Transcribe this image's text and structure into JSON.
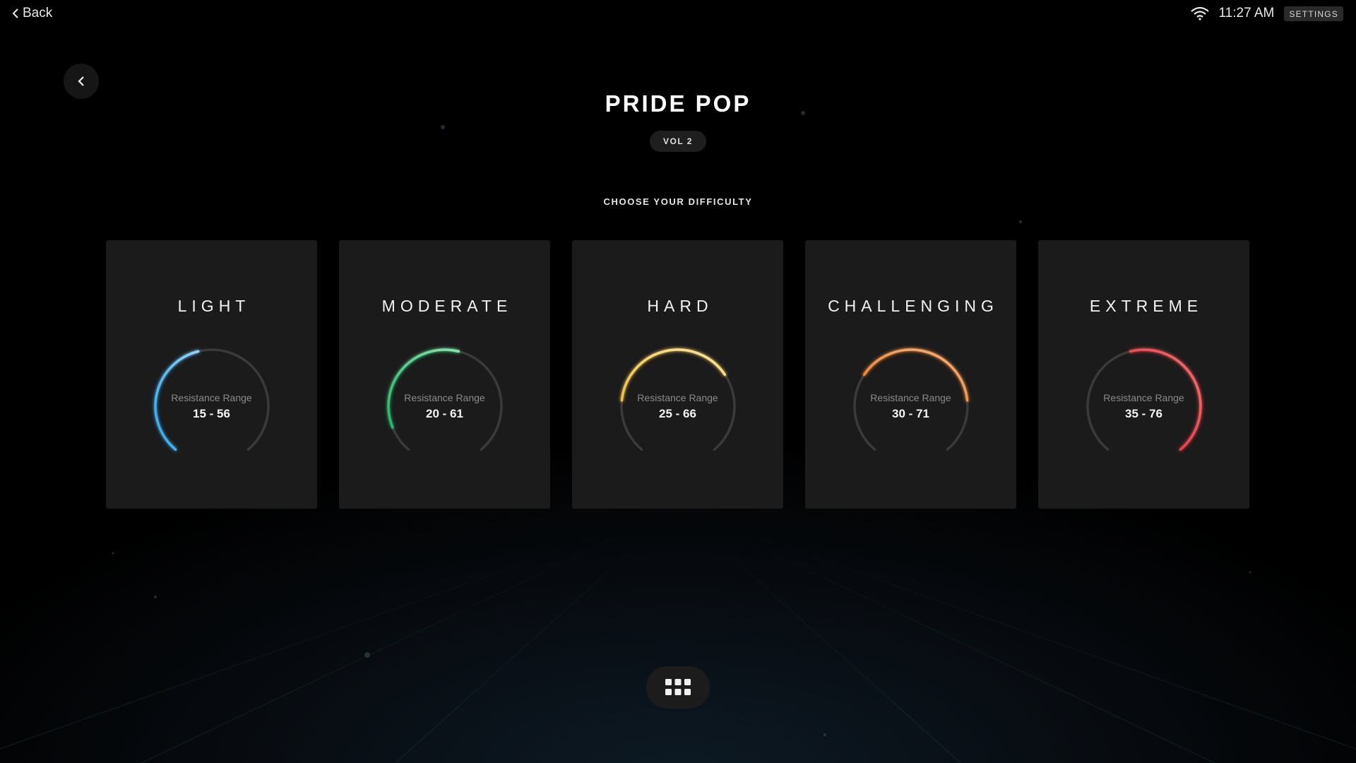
{
  "topbar": {
    "back_label": "Back",
    "time": "11:27 AM",
    "settings_label": "SETTINGS"
  },
  "class": {
    "title": "PRIDE POP",
    "volume": "VOL 2",
    "prompt": "CHOOSE YOUR DIFFICULTY"
  },
  "difficulties": [
    {
      "name": "LIGHT",
      "range_label": "Resistance Range",
      "range": "15 - 56",
      "color": "#2aa8f0",
      "color_light": "#8ad4ff",
      "arc_start": 0.0,
      "arc_end": 0.45
    },
    {
      "name": "MODERATE",
      "range_label": "Resistance Range",
      "range": "20 - 61",
      "color": "#21b867",
      "color_light": "#7de8a7",
      "arc_start": 0.1,
      "arc_end": 0.55
    },
    {
      "name": "HARD",
      "range_label": "Resistance Range",
      "range": "25 - 66",
      "color": "#f0c040",
      "color_light": "#ffe590",
      "arc_start": 0.2,
      "arc_end": 0.7
    },
    {
      "name": "CHALLENGING",
      "range_label": "Resistance Range",
      "range": "30 - 71",
      "color": "#f07a20",
      "color_light": "#ffb070",
      "arc_start": 0.3,
      "arc_end": 0.8
    },
    {
      "name": "EXTREME",
      "range_label": "Resistance Range",
      "range": "35 - 76",
      "color": "#e8202e",
      "color_light": "#ff7070",
      "arc_start": 0.45,
      "arc_end": 1.0
    }
  ],
  "colors": {
    "background": "#000000",
    "card": "#1b1b1b",
    "track": "#3a3a3a"
  },
  "icons": {
    "back": "chevron-left-icon",
    "wifi": "wifi-icon",
    "menu": "grid-icon"
  }
}
